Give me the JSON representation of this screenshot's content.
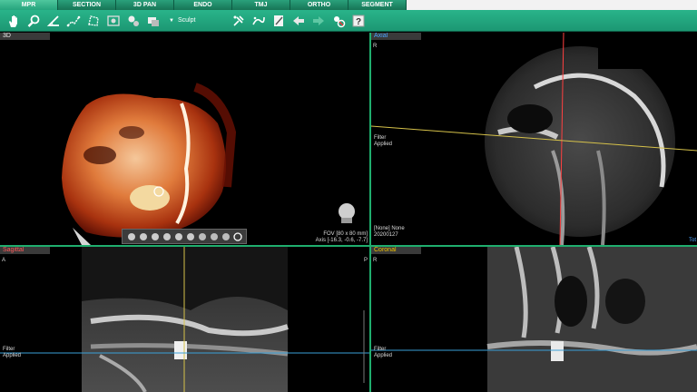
{
  "tabs": [
    {
      "label": "MPR",
      "active": true
    },
    {
      "label": "SECTION",
      "active": false
    },
    {
      "label": "3D PAN",
      "active": false
    },
    {
      "label": "ENDO",
      "active": false
    },
    {
      "label": "TMJ",
      "active": false
    },
    {
      "label": "ORTHO",
      "active": false
    },
    {
      "label": "SEGMENT",
      "active": false
    }
  ],
  "toolbar": {
    "icons": [
      "hand-icon",
      "zoom-icon",
      "angle-icon",
      "measure-icon",
      "area-icon",
      "screenshot-icon",
      "gear-users-icon",
      "layers-icon"
    ],
    "sculpt_label": "Sculpt",
    "right_icons": [
      "implant-icon",
      "nerve-icon",
      "note-icon",
      "undo-icon",
      "redo-icon",
      "settings-icon",
      "help-icon"
    ]
  },
  "panels": {
    "three_d": {
      "label": "3D",
      "fov": "FOV [80 x 80 mm]",
      "axis": "Axis [-16.3, -0.6, -7.7]"
    },
    "axial": {
      "label": "Axial",
      "orient_r": "R",
      "filter": "Filter",
      "applied": "Applied",
      "preset": "[None] None",
      "date": "20200127",
      "corner": "Tot"
    },
    "sagittal": {
      "label": "Sagittal",
      "orient_a": "A",
      "orient_p": "P",
      "filter": "Filter",
      "applied": "Applied"
    },
    "coronal": {
      "label": "Coronal",
      "orient_r": "R",
      "filter": "Filter",
      "applied": "Applied"
    }
  },
  "colors": {
    "toolbar": "#1f9c77",
    "axial_label": "#4aa3ff",
    "sagittal_label": "#ff5a5a",
    "coronal_label": "#f2c200",
    "crosshair_red": "#ff4040",
    "crosshair_yellow": "#d6c24a",
    "crosshair_blue": "#3aa0d8",
    "divider": "#1fae6e"
  }
}
